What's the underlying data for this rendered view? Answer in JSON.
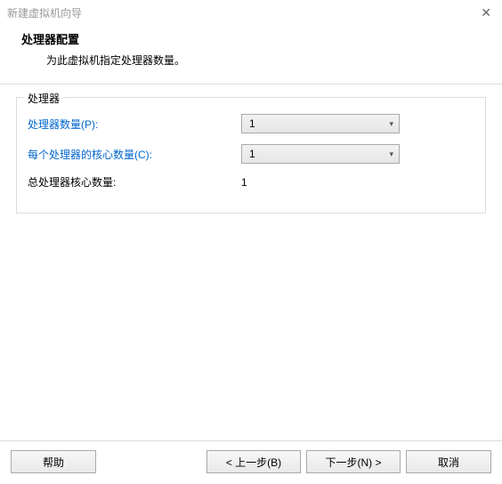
{
  "window": {
    "title": "新建虚拟机向导"
  },
  "header": {
    "title": "处理器配置",
    "description": "为此虚拟机指定处理器数量。"
  },
  "group": {
    "title": "处理器",
    "rows": {
      "processor_count": {
        "label": "处理器数量(P):",
        "value": "1"
      },
      "cores_per_proc": {
        "label": "每个处理器的核心数量(C):",
        "value": "1"
      },
      "total_cores": {
        "label": "总处理器核心数量:",
        "value": "1"
      }
    }
  },
  "footer": {
    "help": "帮助",
    "back": "< 上一步(B)",
    "next": "下一步(N) >",
    "cancel": "取消"
  }
}
